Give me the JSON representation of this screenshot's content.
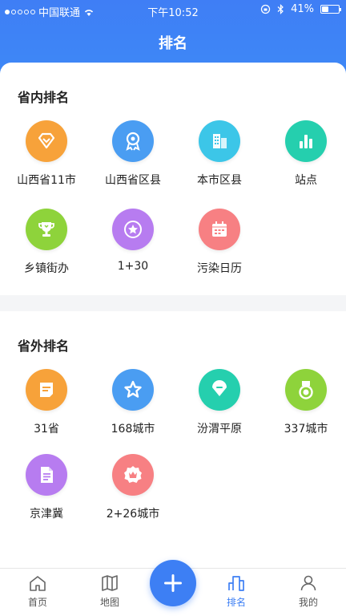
{
  "status_bar": {
    "carrier": "中国联通",
    "time": "下午10:52",
    "battery": "41%",
    "battery_level": 0.41
  },
  "header": {
    "title": "排名"
  },
  "sections": [
    {
      "title": "省内排名",
      "items": [
        {
          "label": "山西省11市",
          "icon": "diamond-icon",
          "color": "#f7a23a"
        },
        {
          "label": "山西省区县",
          "icon": "medal-icon",
          "color": "#4a9df2"
        },
        {
          "label": "本市区县",
          "icon": "building-icon",
          "color": "#3cc6e8"
        },
        {
          "label": "站点",
          "icon": "bar-chart-icon",
          "color": "#25cfae"
        },
        {
          "label": "乡镇街办",
          "icon": "trophy-icon",
          "color": "#8ed33b"
        },
        {
          "label": "1+30",
          "icon": "star-icon",
          "color": "#b77cf0"
        },
        {
          "label": "污染日历",
          "icon": "calendar-icon",
          "color": "#f78083"
        }
      ]
    },
    {
      "title": "省外排名",
      "items": [
        {
          "label": "31省",
          "icon": "note-icon",
          "color": "#f7a23a"
        },
        {
          "label": "168城市",
          "icon": "star-outline-icon",
          "color": "#4a9df2"
        },
        {
          "label": "汾渭平原",
          "icon": "gem-icon",
          "color": "#25cfae"
        },
        {
          "label": "337城市",
          "icon": "ribbon-medal-icon",
          "color": "#8ed33b"
        },
        {
          "label": "京津冀",
          "icon": "document-icon",
          "color": "#b77cf0"
        },
        {
          "label": "2+26城市",
          "icon": "crown-badge-icon",
          "color": "#f78083"
        }
      ]
    }
  ],
  "tabbar": {
    "items": [
      {
        "label": "首页",
        "icon": "home-icon"
      },
      {
        "label": "地图",
        "icon": "map-icon"
      },
      {
        "label": "排名",
        "icon": "ranking-icon",
        "active": true
      },
      {
        "label": "我的",
        "icon": "user-icon"
      }
    ],
    "fab_icon": "plus-icon",
    "accent_color": "#3d7ff4"
  }
}
